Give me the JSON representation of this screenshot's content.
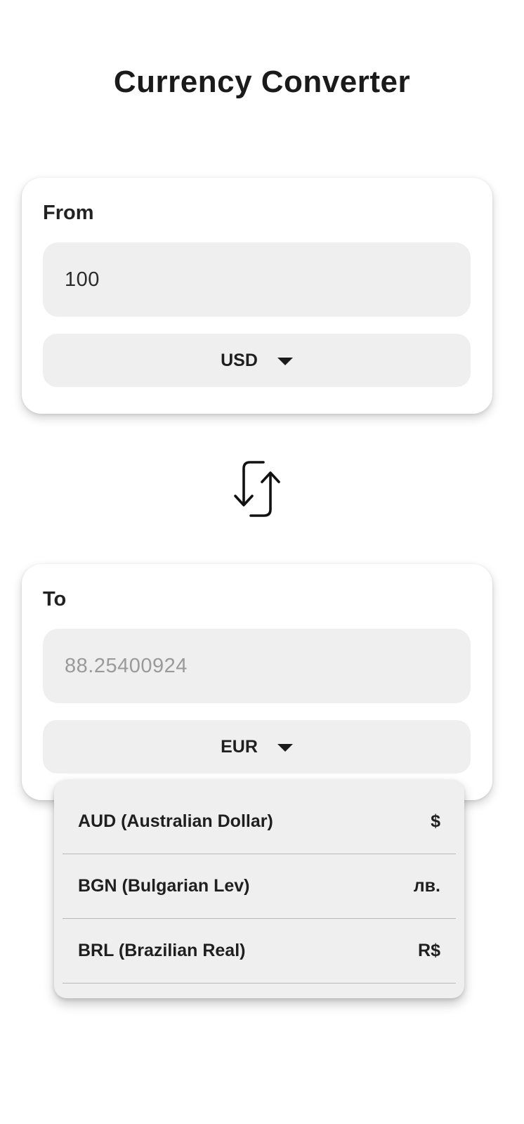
{
  "title": "Currency Converter",
  "from": {
    "label": "From",
    "amount": "100",
    "currency": "USD"
  },
  "to": {
    "label": "To",
    "amount": "88.25400924",
    "currency": "EUR"
  },
  "swap": {
    "icon": "swap-vertical-arrows-icon"
  },
  "dropdown": {
    "items": [
      {
        "name": "AUD (Australian Dollar)",
        "symbol": "$"
      },
      {
        "name": "BGN (Bulgarian Lev)",
        "symbol": "лв."
      },
      {
        "name": "BRL (Brazilian Real)",
        "symbol": "R$"
      }
    ]
  },
  "colors": {
    "field_background": "#efefef",
    "readonly_text": "#9a9a9a"
  }
}
